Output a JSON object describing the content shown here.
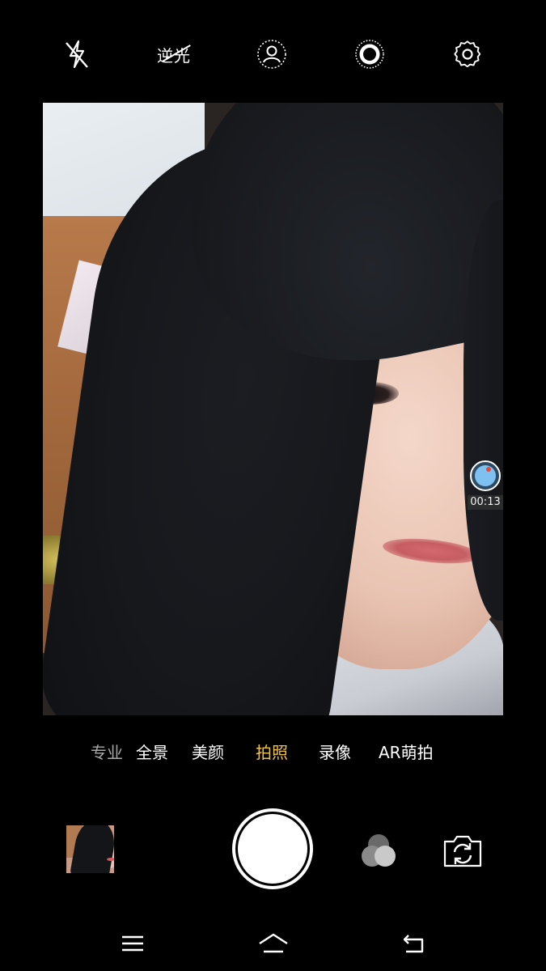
{
  "toolbar": {
    "flash_icon": "flash-off-icon",
    "backlight_label": "逆光",
    "beauty_icon": "portrait-icon",
    "live_icon": "live-photo-icon",
    "settings_icon": "gear-icon"
  },
  "recording": {
    "timer": "00:13",
    "indicator_color": "#7ec0f0",
    "dot_color": "#e24a3b"
  },
  "modes": {
    "items": [
      "专业",
      "全景",
      "美颜",
      "拍照",
      "录像",
      "AR萌拍"
    ],
    "active": "拍照",
    "active_color": "#f1c342"
  },
  "bottom": {
    "gallery_icon": "gallery-thumbnail",
    "shutter_icon": "shutter-button",
    "filter_icon": "filter-icon",
    "switch_icon": "switch-camera-icon"
  },
  "navbar": {
    "menu_icon": "menu-icon",
    "home_icon": "home-icon",
    "back_icon": "back-icon"
  }
}
